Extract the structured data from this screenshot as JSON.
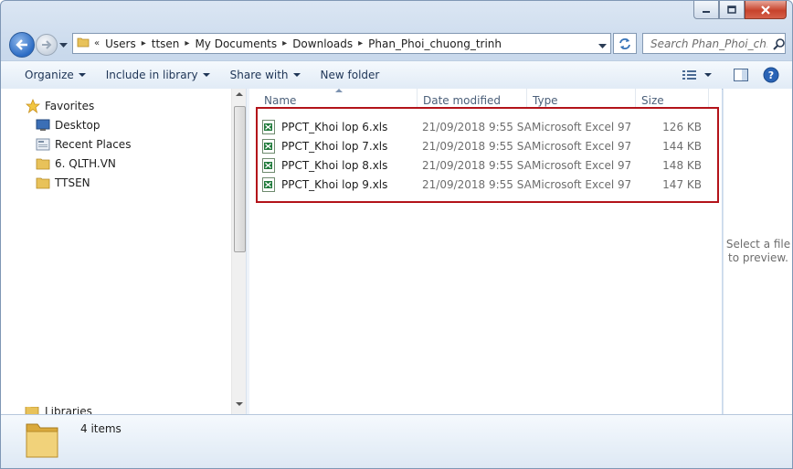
{
  "window": {
    "minimize": "minimize",
    "maximize": "maximize",
    "close": "close"
  },
  "address": {
    "overflow": "«",
    "crumbs": [
      "Users",
      "ttsen",
      "My Documents",
      "Downloads",
      "Phan_Phoi_chuong_trinh"
    ]
  },
  "search": {
    "placeholder": "Search Phan_Phoi_ch..."
  },
  "toolbar": {
    "organize": "Organize",
    "include_in_library": "Include in library",
    "share_with": "Share with",
    "new_folder": "New folder"
  },
  "navpane": {
    "favorites": "Favorites",
    "items": [
      "Desktop",
      "Recent Places",
      "6. QLTH.VN",
      "TTSEN"
    ],
    "libraries": "Libraries"
  },
  "columns": {
    "name": "Name",
    "date": "Date modified",
    "type": "Type",
    "size": "Size"
  },
  "files": [
    {
      "name": "PPCT_Khoi lop 6.xls",
      "date": "21/09/2018 9:55 SA",
      "type": "Microsoft Excel 97...",
      "size": "126 KB"
    },
    {
      "name": "PPCT_Khoi lop 7.xls",
      "date": "21/09/2018 9:55 SA",
      "type": "Microsoft Excel 97...",
      "size": "144 KB"
    },
    {
      "name": "PPCT_Khoi lop 8.xls",
      "date": "21/09/2018 9:55 SA",
      "type": "Microsoft Excel 97...",
      "size": "148 KB"
    },
    {
      "name": "PPCT_Khoi lop 9.xls",
      "date": "21/09/2018 9:55 SA",
      "type": "Microsoft Excel 97...",
      "size": "147 KB"
    }
  ],
  "preview": {
    "line1": "Select a file",
    "line2": "to preview."
  },
  "details": {
    "count": "4 items"
  },
  "colors": {
    "highlight_border": "#b3131a",
    "excel_green": "#1f7a3a",
    "folder_yellow": "#e8c25a"
  }
}
